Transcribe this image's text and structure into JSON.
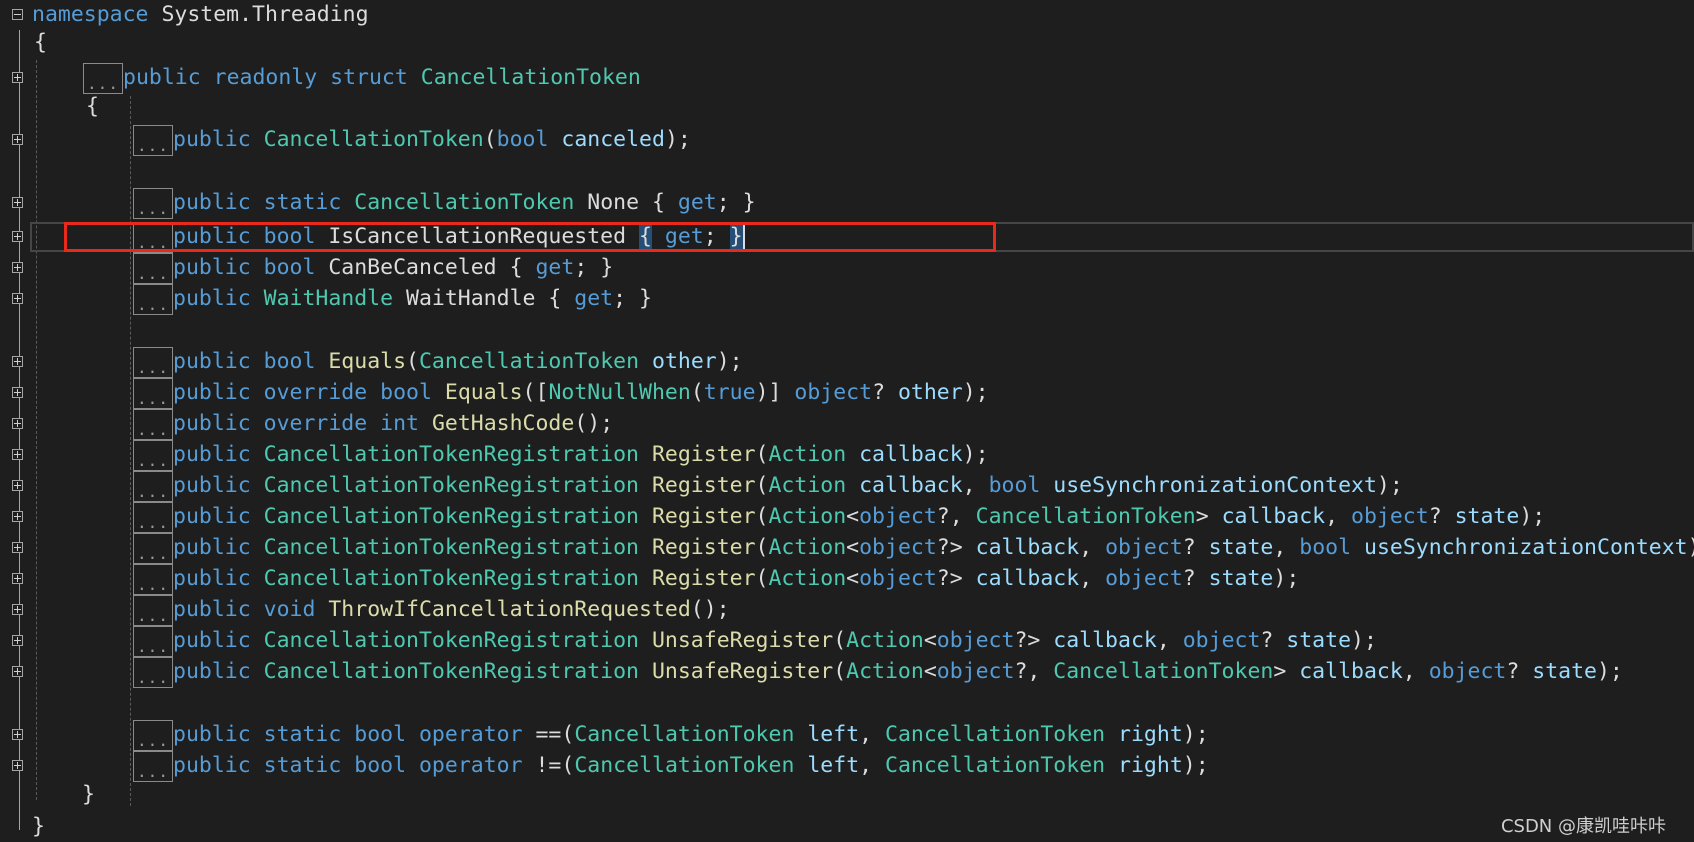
{
  "editor": {
    "namespace_kw": "namespace",
    "namespace_name": "System.Threading",
    "open_brace": "{",
    "close_brace": "}",
    "collapsed_marker": "...",
    "struct_line": {
      "public": "public",
      "readonly": "readonly",
      "struct": "struct",
      "name": "CancellationToken"
    },
    "lines": [
      {
        "id": "ctor",
        "tokens": [
          {
            "c": "kw",
            "t": "public"
          },
          {
            "c": "pl",
            "t": " "
          },
          {
            "c": "ty",
            "t": "CancellationToken"
          },
          {
            "c": "pl",
            "t": "("
          },
          {
            "c": "kw",
            "t": "bool"
          },
          {
            "c": "pl",
            "t": " "
          },
          {
            "c": "pm",
            "t": "canceled"
          },
          {
            "c": "pl",
            "t": ");"
          }
        ]
      },
      {
        "id": "none",
        "tokens": [
          {
            "c": "kw",
            "t": "public"
          },
          {
            "c": "pl",
            "t": " "
          },
          {
            "c": "kw",
            "t": "static"
          },
          {
            "c": "pl",
            "t": " "
          },
          {
            "c": "ty",
            "t": "CancellationToken"
          },
          {
            "c": "pl",
            "t": " None { "
          },
          {
            "c": "kw",
            "t": "get"
          },
          {
            "c": "pl",
            "t": "; }"
          }
        ]
      },
      {
        "id": "iscancel",
        "tokens": [
          {
            "c": "kw",
            "t": "public"
          },
          {
            "c": "pl",
            "t": " "
          },
          {
            "c": "kw",
            "t": "bool"
          },
          {
            "c": "pl",
            "t": " IsCancellationRequested "
          },
          {
            "c": "hl",
            "t": "{"
          },
          {
            "c": "pl",
            "t": " "
          },
          {
            "c": "kw",
            "t": "get"
          },
          {
            "c": "pl",
            "t": "; "
          },
          {
            "c": "hl",
            "t": "}"
          }
        ]
      },
      {
        "id": "canbe",
        "tokens": [
          {
            "c": "kw",
            "t": "public"
          },
          {
            "c": "pl",
            "t": " "
          },
          {
            "c": "kw",
            "t": "bool"
          },
          {
            "c": "pl",
            "t": " CanBeCanceled { "
          },
          {
            "c": "kw",
            "t": "get"
          },
          {
            "c": "pl",
            "t": "; }"
          }
        ]
      },
      {
        "id": "wait",
        "tokens": [
          {
            "c": "kw",
            "t": "public"
          },
          {
            "c": "pl",
            "t": " "
          },
          {
            "c": "ty",
            "t": "WaitHandle"
          },
          {
            "c": "pl",
            "t": " WaitHandle { "
          },
          {
            "c": "kw",
            "t": "get"
          },
          {
            "c": "pl",
            "t": "; }"
          }
        ]
      },
      {
        "id": "eq1",
        "tokens": [
          {
            "c": "kw",
            "t": "public"
          },
          {
            "c": "pl",
            "t": " "
          },
          {
            "c": "kw",
            "t": "bool"
          },
          {
            "c": "pl",
            "t": " "
          },
          {
            "c": "fn",
            "t": "Equals"
          },
          {
            "c": "pl",
            "t": "("
          },
          {
            "c": "ty",
            "t": "CancellationToken"
          },
          {
            "c": "pl",
            "t": " "
          },
          {
            "c": "pm",
            "t": "other"
          },
          {
            "c": "pl",
            "t": ");"
          }
        ]
      },
      {
        "id": "eq2",
        "tokens": [
          {
            "c": "kw",
            "t": "public"
          },
          {
            "c": "pl",
            "t": " "
          },
          {
            "c": "kw",
            "t": "override"
          },
          {
            "c": "pl",
            "t": " "
          },
          {
            "c": "kw",
            "t": "bool"
          },
          {
            "c": "pl",
            "t": " "
          },
          {
            "c": "fn",
            "t": "Equals"
          },
          {
            "c": "pl",
            "t": "(["
          },
          {
            "c": "ty",
            "t": "NotNullWhen"
          },
          {
            "c": "pl",
            "t": "("
          },
          {
            "c": "kw",
            "t": "true"
          },
          {
            "c": "pl",
            "t": ")] "
          },
          {
            "c": "kw",
            "t": "object"
          },
          {
            "c": "pl",
            "t": "? "
          },
          {
            "c": "pm",
            "t": "other"
          },
          {
            "c": "pl",
            "t": ");"
          }
        ]
      },
      {
        "id": "hash",
        "tokens": [
          {
            "c": "kw",
            "t": "public"
          },
          {
            "c": "pl",
            "t": " "
          },
          {
            "c": "kw",
            "t": "override"
          },
          {
            "c": "pl",
            "t": " "
          },
          {
            "c": "kw",
            "t": "int"
          },
          {
            "c": "pl",
            "t": " "
          },
          {
            "c": "fn",
            "t": "GetHashCode"
          },
          {
            "c": "pl",
            "t": "();"
          }
        ]
      },
      {
        "id": "reg1",
        "tokens": [
          {
            "c": "kw",
            "t": "public"
          },
          {
            "c": "pl",
            "t": " "
          },
          {
            "c": "ty",
            "t": "CancellationTokenRegistration"
          },
          {
            "c": "pl",
            "t": " "
          },
          {
            "c": "fn",
            "t": "Register"
          },
          {
            "c": "pl",
            "t": "("
          },
          {
            "c": "ty",
            "t": "Action"
          },
          {
            "c": "pl",
            "t": " "
          },
          {
            "c": "pm",
            "t": "callback"
          },
          {
            "c": "pl",
            "t": ");"
          }
        ]
      },
      {
        "id": "reg2",
        "tokens": [
          {
            "c": "kw",
            "t": "public"
          },
          {
            "c": "pl",
            "t": " "
          },
          {
            "c": "ty",
            "t": "CancellationTokenRegistration"
          },
          {
            "c": "pl",
            "t": " "
          },
          {
            "c": "fn",
            "t": "Register"
          },
          {
            "c": "pl",
            "t": "("
          },
          {
            "c": "ty",
            "t": "Action"
          },
          {
            "c": "pl",
            "t": " "
          },
          {
            "c": "pm",
            "t": "callback"
          },
          {
            "c": "pl",
            "t": ", "
          },
          {
            "c": "kw",
            "t": "bool"
          },
          {
            "c": "pl",
            "t": " "
          },
          {
            "c": "pm",
            "t": "useSynchronizationContext"
          },
          {
            "c": "pl",
            "t": ");"
          }
        ]
      },
      {
        "id": "reg3",
        "tokens": [
          {
            "c": "kw",
            "t": "public"
          },
          {
            "c": "pl",
            "t": " "
          },
          {
            "c": "ty",
            "t": "CancellationTokenRegistration"
          },
          {
            "c": "pl",
            "t": " "
          },
          {
            "c": "fn",
            "t": "Register"
          },
          {
            "c": "pl",
            "t": "("
          },
          {
            "c": "ty",
            "t": "Action"
          },
          {
            "c": "pl",
            "t": "<"
          },
          {
            "c": "kw",
            "t": "object"
          },
          {
            "c": "pl",
            "t": "?, "
          },
          {
            "c": "ty",
            "t": "CancellationToken"
          },
          {
            "c": "pl",
            "t": "> "
          },
          {
            "c": "pm",
            "t": "callback"
          },
          {
            "c": "pl",
            "t": ", "
          },
          {
            "c": "kw",
            "t": "object"
          },
          {
            "c": "pl",
            "t": "? "
          },
          {
            "c": "pm",
            "t": "state"
          },
          {
            "c": "pl",
            "t": ");"
          }
        ]
      },
      {
        "id": "reg4",
        "tokens": [
          {
            "c": "kw",
            "t": "public"
          },
          {
            "c": "pl",
            "t": " "
          },
          {
            "c": "ty",
            "t": "CancellationTokenRegistration"
          },
          {
            "c": "pl",
            "t": " "
          },
          {
            "c": "fn",
            "t": "Register"
          },
          {
            "c": "pl",
            "t": "("
          },
          {
            "c": "ty",
            "t": "Action"
          },
          {
            "c": "pl",
            "t": "<"
          },
          {
            "c": "kw",
            "t": "object"
          },
          {
            "c": "pl",
            "t": "?> "
          },
          {
            "c": "pm",
            "t": "callback"
          },
          {
            "c": "pl",
            "t": ", "
          },
          {
            "c": "kw",
            "t": "object"
          },
          {
            "c": "pl",
            "t": "? "
          },
          {
            "c": "pm",
            "t": "state"
          },
          {
            "c": "pl",
            "t": ", "
          },
          {
            "c": "kw",
            "t": "bool"
          },
          {
            "c": "pl",
            "t": " "
          },
          {
            "c": "pm",
            "t": "useSynchronizationContext"
          },
          {
            "c": "pl",
            "t": ")"
          }
        ]
      },
      {
        "id": "reg5",
        "tokens": [
          {
            "c": "kw",
            "t": "public"
          },
          {
            "c": "pl",
            "t": " "
          },
          {
            "c": "ty",
            "t": "CancellationTokenRegistration"
          },
          {
            "c": "pl",
            "t": " "
          },
          {
            "c": "fn",
            "t": "Register"
          },
          {
            "c": "pl",
            "t": "("
          },
          {
            "c": "ty",
            "t": "Action"
          },
          {
            "c": "pl",
            "t": "<"
          },
          {
            "c": "kw",
            "t": "object"
          },
          {
            "c": "pl",
            "t": "?> "
          },
          {
            "c": "pm",
            "t": "callback"
          },
          {
            "c": "pl",
            "t": ", "
          },
          {
            "c": "kw",
            "t": "object"
          },
          {
            "c": "pl",
            "t": "? "
          },
          {
            "c": "pm",
            "t": "state"
          },
          {
            "c": "pl",
            "t": ");"
          }
        ]
      },
      {
        "id": "throw",
        "tokens": [
          {
            "c": "kw",
            "t": "public"
          },
          {
            "c": "pl",
            "t": " "
          },
          {
            "c": "kw",
            "t": "void"
          },
          {
            "c": "pl",
            "t": " "
          },
          {
            "c": "fn",
            "t": "ThrowIfCancellationRequested"
          },
          {
            "c": "pl",
            "t": "();"
          }
        ]
      },
      {
        "id": "unsafe1",
        "tokens": [
          {
            "c": "kw",
            "t": "public"
          },
          {
            "c": "pl",
            "t": " "
          },
          {
            "c": "ty",
            "t": "CancellationTokenRegistration"
          },
          {
            "c": "pl",
            "t": " "
          },
          {
            "c": "fn",
            "t": "UnsafeRegister"
          },
          {
            "c": "pl",
            "t": "("
          },
          {
            "c": "ty",
            "t": "Action"
          },
          {
            "c": "pl",
            "t": "<"
          },
          {
            "c": "kw",
            "t": "object"
          },
          {
            "c": "pl",
            "t": "?> "
          },
          {
            "c": "pm",
            "t": "callback"
          },
          {
            "c": "pl",
            "t": ", "
          },
          {
            "c": "kw",
            "t": "object"
          },
          {
            "c": "pl",
            "t": "? "
          },
          {
            "c": "pm",
            "t": "state"
          },
          {
            "c": "pl",
            "t": ");"
          }
        ]
      },
      {
        "id": "unsafe2",
        "tokens": [
          {
            "c": "kw",
            "t": "public"
          },
          {
            "c": "pl",
            "t": " "
          },
          {
            "c": "ty",
            "t": "CancellationTokenRegistration"
          },
          {
            "c": "pl",
            "t": " "
          },
          {
            "c": "fn",
            "t": "UnsafeRegister"
          },
          {
            "c": "pl",
            "t": "("
          },
          {
            "c": "ty",
            "t": "Action"
          },
          {
            "c": "pl",
            "t": "<"
          },
          {
            "c": "kw",
            "t": "object"
          },
          {
            "c": "pl",
            "t": "?, "
          },
          {
            "c": "ty",
            "t": "CancellationToken"
          },
          {
            "c": "pl",
            "t": "> "
          },
          {
            "c": "pm",
            "t": "callback"
          },
          {
            "c": "pl",
            "t": ", "
          },
          {
            "c": "kw",
            "t": "object"
          },
          {
            "c": "pl",
            "t": "? "
          },
          {
            "c": "pm",
            "t": "state"
          },
          {
            "c": "pl",
            "t": ");"
          }
        ]
      },
      {
        "id": "opeq",
        "tokens": [
          {
            "c": "kw",
            "t": "public"
          },
          {
            "c": "pl",
            "t": " "
          },
          {
            "c": "kw",
            "t": "static"
          },
          {
            "c": "pl",
            "t": " "
          },
          {
            "c": "kw",
            "t": "bool"
          },
          {
            "c": "pl",
            "t": " "
          },
          {
            "c": "kw",
            "t": "operator"
          },
          {
            "c": "pl",
            "t": " =="
          },
          {
            "c": "pl",
            "t": "("
          },
          {
            "c": "ty",
            "t": "CancellationToken"
          },
          {
            "c": "pl",
            "t": " "
          },
          {
            "c": "pm",
            "t": "left"
          },
          {
            "c": "pl",
            "t": ", "
          },
          {
            "c": "ty",
            "t": "CancellationToken"
          },
          {
            "c": "pl",
            "t": " "
          },
          {
            "c": "pm",
            "t": "right"
          },
          {
            "c": "pl",
            "t": ");"
          }
        ]
      },
      {
        "id": "opne",
        "tokens": [
          {
            "c": "kw",
            "t": "public"
          },
          {
            "c": "pl",
            "t": " "
          },
          {
            "c": "kw",
            "t": "static"
          },
          {
            "c": "pl",
            "t": " "
          },
          {
            "c": "kw",
            "t": "bool"
          },
          {
            "c": "pl",
            "t": " "
          },
          {
            "c": "kw",
            "t": "operator"
          },
          {
            "c": "pl",
            "t": " !="
          },
          {
            "c": "pl",
            "t": "("
          },
          {
            "c": "ty",
            "t": "CancellationToken"
          },
          {
            "c": "pl",
            "t": " "
          },
          {
            "c": "pm",
            "t": "left"
          },
          {
            "c": "pl",
            "t": ", "
          },
          {
            "c": "ty",
            "t": "CancellationToken"
          },
          {
            "c": "pl",
            "t": " "
          },
          {
            "c": "pm",
            "t": "right"
          },
          {
            "c": "pl",
            "t": ");"
          }
        ]
      }
    ]
  },
  "watermark": "CSDN @康凯哇咔咔",
  "colors": {
    "background": "#1e1e1e",
    "keyword": "#569cd6",
    "type": "#4ec9b0",
    "method": "#dcdcaa",
    "parameter": "#9cdcfe",
    "highlight_box": "#e8291b"
  }
}
